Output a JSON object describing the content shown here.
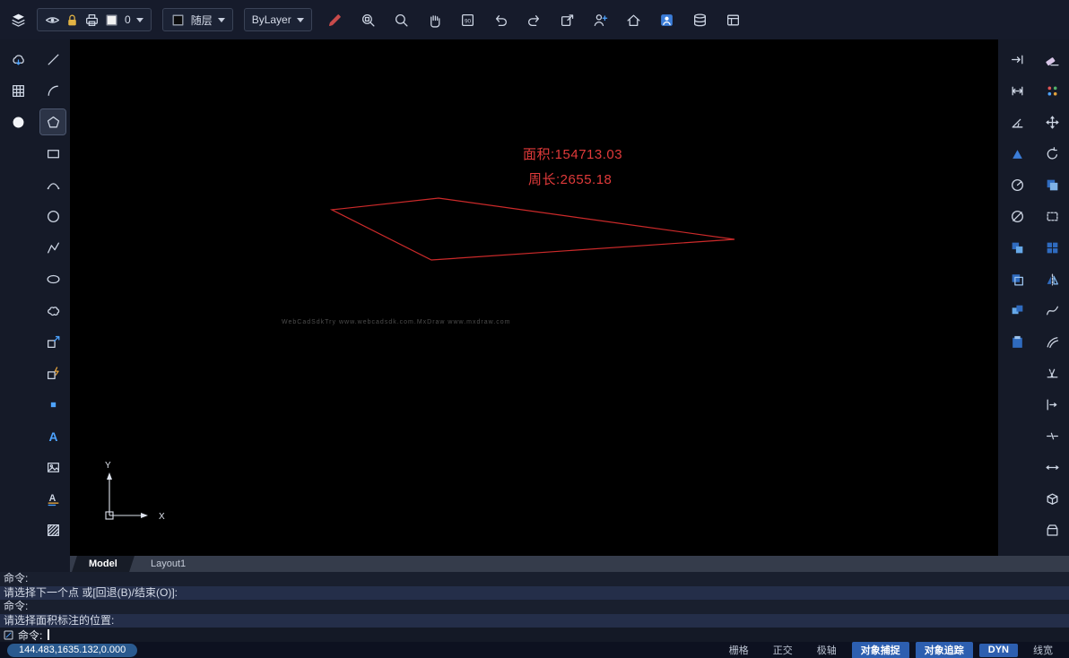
{
  "colors": {
    "entity_red": "#cc2a2a",
    "label_red": "#e03a3a",
    "active_toggle_blue": "#2d5fb0",
    "toolbar_bg": "#161b2b",
    "canvas_bg": "#000000"
  },
  "topbar": {
    "layer_control": {
      "value": "0",
      "icons": [
        "eye-icon",
        "lock-icon",
        "printer-icon",
        "white-swatch-icon"
      ]
    },
    "color_control": {
      "value": "随层",
      "swatch": "bylayer-swatch-icon"
    },
    "linetype_control": {
      "value": "ByLayer"
    },
    "tools": [
      {
        "name": "draw-style-tool",
        "icon": "pencil-red-icon"
      },
      {
        "name": "zoom-window-tool",
        "icon": "zoom-window-icon"
      },
      {
        "name": "zoom-extents-tool",
        "icon": "zoom-icon"
      },
      {
        "name": "pan-tool",
        "icon": "pan-hand-icon"
      },
      {
        "name": "ortho-90-tool",
        "icon": "ortho-90-icon"
      },
      {
        "name": "undo-tool",
        "icon": "undo-icon"
      },
      {
        "name": "redo-tool",
        "icon": "redo-icon"
      },
      {
        "name": "new-window-tool",
        "icon": "window-arrow-icon"
      },
      {
        "name": "share-user-tool",
        "icon": "user-add-icon"
      },
      {
        "name": "home-tool",
        "icon": "home-icon"
      },
      {
        "name": "account-tool",
        "icon": "user-badge-icon"
      },
      {
        "name": "database-tool",
        "icon": "database-icon"
      },
      {
        "name": "sheet-tool",
        "icon": "sheet-icon"
      }
    ]
  },
  "left_toolbar": {
    "secondary": [
      {
        "name": "cloud-download-tool",
        "icon": "cloud-download-icon"
      },
      {
        "name": "table-tool",
        "icon": "table-icon"
      },
      {
        "name": "record-tool",
        "icon": "record-dot-icon"
      }
    ],
    "tools": [
      {
        "name": "line-tool",
        "icon": "line-icon"
      },
      {
        "name": "arc-tool",
        "icon": "arc-icon"
      },
      {
        "name": "polygon-tool",
        "icon": "polygon-icon",
        "active": true
      },
      {
        "name": "rectangle-tool",
        "icon": "rectangle-icon"
      },
      {
        "name": "arc-3point-tool",
        "icon": "arc3-icon"
      },
      {
        "name": "circle-tool",
        "icon": "circle-icon"
      },
      {
        "name": "polyline-tool",
        "icon": "polyline-icon"
      },
      {
        "name": "ellipse-tool",
        "icon": "ellipse-icon"
      },
      {
        "name": "revcloud-tool",
        "icon": "revcloud-icon"
      },
      {
        "name": "insert-block-tool",
        "icon": "insert-block-icon"
      },
      {
        "name": "dynamic-block-tool",
        "icon": "dynamic-block-icon"
      },
      {
        "name": "point-tool",
        "icon": "point-icon"
      },
      {
        "name": "text-tool",
        "icon": "text-a-icon"
      },
      {
        "name": "image-tool",
        "icon": "image-icon"
      },
      {
        "name": "attribute-text-tool",
        "icon": "attribute-icon"
      },
      {
        "name": "hatch-tool",
        "icon": "hatch-icon"
      }
    ]
  },
  "right_toolbar": {
    "measure_tools": [
      {
        "name": "dim-align-tool",
        "icon": "dim-align-icon"
      },
      {
        "name": "dim-linear-tool",
        "icon": "dim-linear-icon"
      },
      {
        "name": "dim-angle-tool",
        "icon": "dim-angle-icon"
      },
      {
        "name": "dim-area-tool",
        "icon": "dim-area-icon"
      },
      {
        "name": "dim-radius-tool",
        "icon": "dim-radius-icon"
      },
      {
        "name": "dim-diameter-tool",
        "icon": "dim-diameter-icon"
      },
      {
        "name": "match-prop-tool",
        "icon": "match-prop-icon"
      },
      {
        "name": "layer-stack-tool",
        "icon": "layer-stack-icon"
      },
      {
        "name": "block-copy-tool",
        "icon": "block-copy-icon"
      },
      {
        "name": "paste-tool",
        "icon": "paste-icon"
      }
    ],
    "modify_tools": [
      {
        "name": "erase-tool",
        "icon": "erase-icon"
      },
      {
        "name": "point-style-tool",
        "icon": "point-style-icon"
      },
      {
        "name": "move-tool",
        "icon": "move-icon"
      },
      {
        "name": "rotate-tool",
        "icon": "rotate-icon"
      },
      {
        "name": "copy-tool",
        "icon": "copy-icon"
      },
      {
        "name": "stretch-tool",
        "icon": "stretch-icon"
      },
      {
        "name": "array-tool",
        "icon": "array-icon"
      },
      {
        "name": "mirror-tool",
        "icon": "mirror-icon"
      },
      {
        "name": "spline-tool",
        "icon": "spline-icon"
      },
      {
        "name": "offset-tool",
        "icon": "offset-icon"
      },
      {
        "name": "trim-tool",
        "icon": "trim-icon"
      },
      {
        "name": "extend-tool",
        "icon": "extend-icon"
      },
      {
        "name": "break-tool",
        "icon": "break-icon"
      },
      {
        "name": "lengthen-tool",
        "icon": "lengthen-icon"
      },
      {
        "name": "box3d-tool",
        "icon": "box3d-icon"
      },
      {
        "name": "unfold-tool",
        "icon": "unfold-icon"
      }
    ]
  },
  "canvas": {
    "area_label": "面积:154713.03",
    "perimeter_label": "周长:2655.18",
    "watermark": "WebCadSdkTry www.webcadsdk.com.MxDraw www.mxdraw.com",
    "polygon_points": "292,190 411,177 741,223 403,246",
    "ucs": {
      "x_label": "X",
      "y_label": "Y"
    }
  },
  "tabs": {
    "items": [
      {
        "label": "Model",
        "active": true
      },
      {
        "label": "Layout1",
        "active": false
      }
    ]
  },
  "command_panel": {
    "lines": [
      {
        "text": "命令:",
        "highlight": false
      },
      {
        "text": "请选择下一个点 或[回退(B)/结束(O)]:",
        "highlight": true
      },
      {
        "text": "命令:",
        "highlight": false
      },
      {
        "text": "请选择面积标注的位置:",
        "highlight": true
      }
    ],
    "input_prompt": "命令:"
  },
  "statusbar": {
    "coordinates": "144.483,1635.132,0.000",
    "toggles": [
      {
        "key": "grid",
        "label": "栅格",
        "active": false
      },
      {
        "key": "ortho",
        "label": "正交",
        "active": false
      },
      {
        "key": "polar",
        "label": "极轴",
        "active": false
      },
      {
        "key": "osnap",
        "label": "对象捕捉",
        "active": true
      },
      {
        "key": "otrack",
        "label": "对象追踪",
        "active": true
      },
      {
        "key": "dyn",
        "label": "DYN",
        "active": true
      },
      {
        "key": "lineweight",
        "label": "线宽",
        "active": false
      }
    ]
  }
}
